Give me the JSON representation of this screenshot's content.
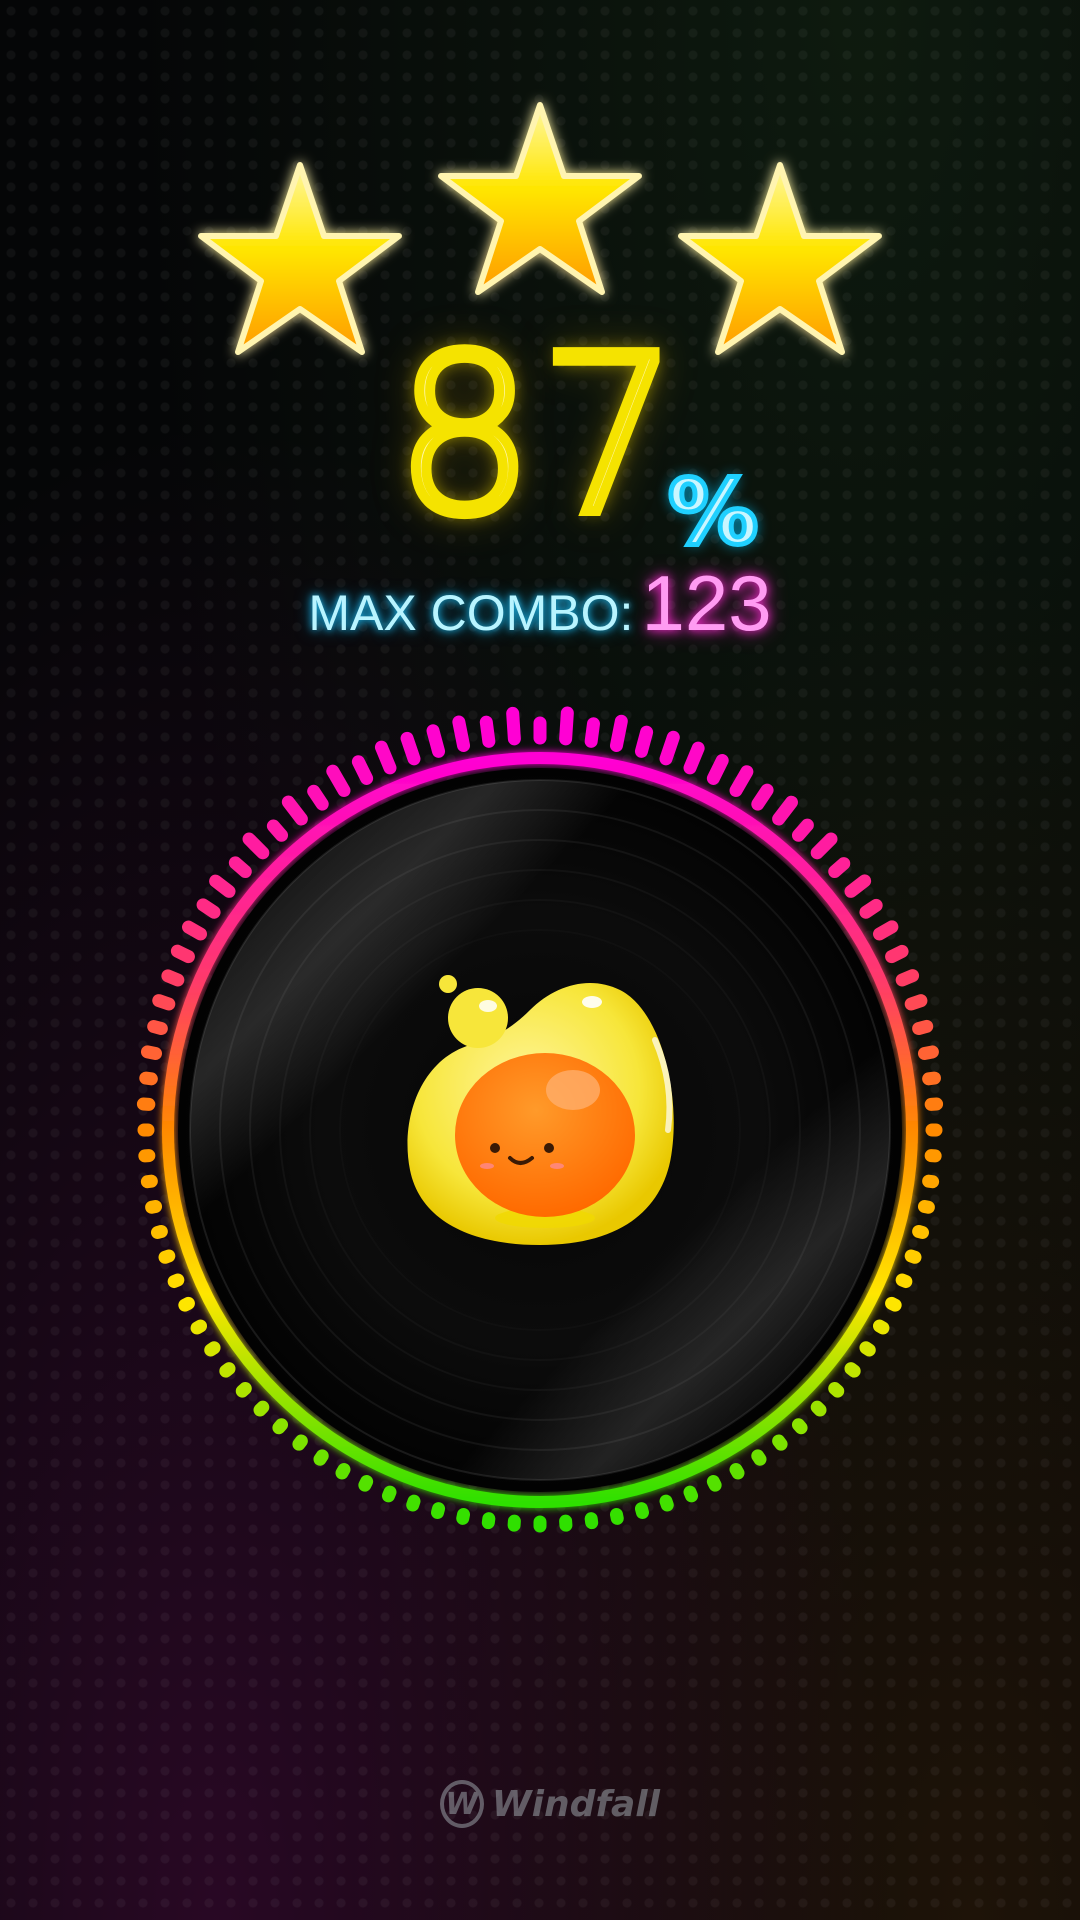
{
  "result": {
    "stars_earned": 3,
    "stars_total": 3,
    "accuracy_value": "87",
    "accuracy_unit": "%",
    "max_combo_label": "MAX COMBO:",
    "max_combo_value": "123"
  },
  "branding": {
    "logo_mark": "W",
    "logo_text": "Windfall"
  },
  "icons": {
    "star": "star-icon",
    "record": "vinyl-record",
    "mascot": "yellow-blob-mascot"
  },
  "colors": {
    "star_yellow": "#ffe600",
    "score_yellow": "#f5e300",
    "percent_cyan": "#1fd0ff",
    "combo_cyan": "#22c8ff",
    "combo_pink": "#ff2bd6",
    "ring_top": "#ff00cc",
    "ring_side": "#ff7a00",
    "ring_low": "#ffe600",
    "ring_bottom": "#35e000"
  }
}
